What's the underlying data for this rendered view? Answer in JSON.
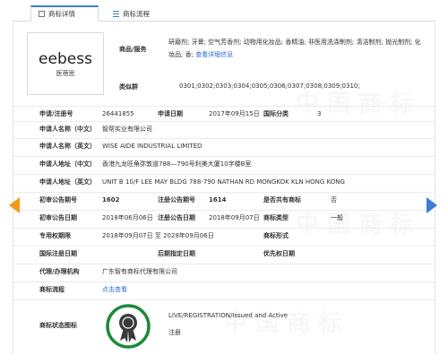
{
  "tabs": [
    {
      "label": "商标详情",
      "active": true,
      "icon": "document-icon"
    },
    {
      "label": "商标流程",
      "active": false,
      "icon": "list-icon"
    }
  ],
  "logo": {
    "text": "eebess",
    "cn": "医蓓思"
  },
  "goods": {
    "label": "商品/服务",
    "text": "研磨剂; 牙膏; 空气芳香剂; 动物用化妆品; 香精油; 非医用洗涤制剂; 清洁制剂; 抛光制剂; 化妆品; 香;",
    "link": "查看详细信息"
  },
  "classes": {
    "label": "类似群",
    "value": "0301;0302;0303;0304;0305;0306;0307;0308;0309;0310;"
  },
  "fields": {
    "reg_no_label": "申请/注册号",
    "reg_no": "26441855",
    "apply_date_label": "申请日期",
    "apply_date": "2017年09月15日",
    "intl_class_label": "国际分类",
    "intl_class": "3",
    "applicant_cn_label": "申请人名称（中文）",
    "applicant_cn": "智帮实业有限公司",
    "applicant_en_label": "申请人名称（英文）",
    "applicant_en": "WISE AIDE INDUSTRIAL LIMITED",
    "address_cn_label": "申请人地址（中文）",
    "address_cn": "香港九龙旺角弥敦道788—790号利美大厦10字楼B室",
    "address_en_label": "申请人地址（英文）",
    "address_en": "UNIT B 10/F LEE MAY BLDG 788-790 NATHAN RD MONGKOK KLN HONG KONG",
    "prelim_no_label": "初审公告期号",
    "prelim_no": "1602",
    "reg_pub_no_label": "注册公告期号",
    "reg_pub_no": "1614",
    "shared_label": "是否共有商标",
    "shared": "否",
    "prelim_date_label": "初审公告日期",
    "prelim_date": "2018年06月06日",
    "reg_pub_date_label": "注册公告日期",
    "reg_pub_date": "2018年09月07日",
    "tm_type_label": "商标类型",
    "tm_type": "一般",
    "exclusive_label": "专用权期限",
    "exclusive": "2018年09月07日 至 2028年09月06日",
    "tm_form_label": "商标形式",
    "tm_form": "",
    "intl_reg_date_label": "国际注册日期",
    "intl_reg_date": "",
    "later_date_label": "后期指定日期",
    "later_date": "",
    "priority_date_label": "优先权日期",
    "priority_date": "",
    "agent_label": "代理/办理机构",
    "agent": "广东智有商标代理有限公司",
    "process_label": "商标流程",
    "process_link": "点击查看",
    "status_label": "商标状态图标",
    "status_en": "LIVE/REGISTRATION/Issued and Active",
    "status_cn": "注册"
  },
  "colors": {
    "accent": "#3a7fd5",
    "arrow_left": "#f29a1c",
    "badge_ring": "#1a8a3a",
    "link": "#2c6bd3"
  }
}
